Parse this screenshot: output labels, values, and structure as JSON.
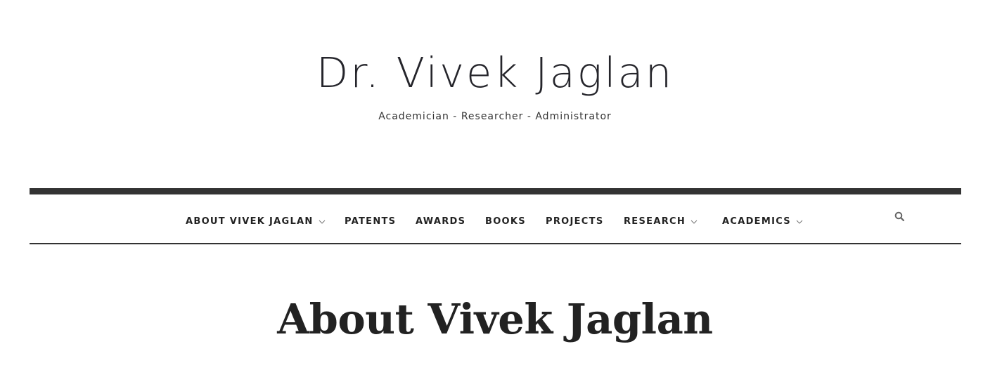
{
  "header": {
    "site_title": "Dr. Vivek Jaglan",
    "tagline": "Academician - Researcher - Administrator"
  },
  "nav": {
    "items": [
      {
        "label": "ABOUT VIVEK JAGLAN",
        "has_dropdown": true
      },
      {
        "label": "PATENTS",
        "has_dropdown": false
      },
      {
        "label": "AWARDS",
        "has_dropdown": false
      },
      {
        "label": "BOOKS",
        "has_dropdown": false
      },
      {
        "label": "PROJECTS",
        "has_dropdown": false
      },
      {
        "label": "RESEARCH",
        "has_dropdown": true
      },
      {
        "label": "ACADEMICS",
        "has_dropdown": true
      }
    ],
    "search_icon": "search-icon"
  },
  "main": {
    "page_title": "About Vivek Jaglan"
  },
  "colors": {
    "text": "#222222",
    "nav_border": "#333333",
    "background": "#ffffff"
  }
}
